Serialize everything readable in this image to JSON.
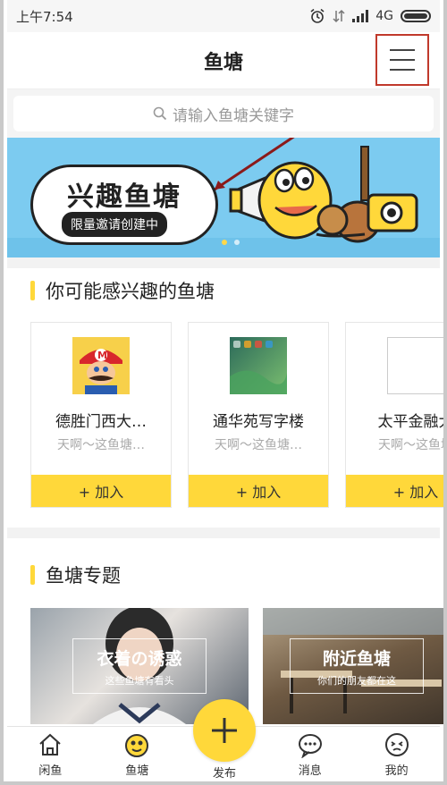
{
  "status_bar": {
    "time": "上午7:54",
    "network": "4G"
  },
  "nav": {
    "title": "鱼塘",
    "menu_icon": "menu-icon"
  },
  "search": {
    "placeholder": "请输入鱼塘关键字"
  },
  "banner": {
    "title": "兴趣鱼塘",
    "subtitle": "限量邀请创建中"
  },
  "recommend": {
    "title": "你可能感兴趣的鱼塘",
    "cards": [
      {
        "name": "德胜门西大…",
        "desc": "天啊～这鱼塘…",
        "join": "+ 加入"
      },
      {
        "name": "通华苑写字楼",
        "desc": "天啊～这鱼塘…",
        "join": "+ 加入"
      },
      {
        "name": "太平金融大",
        "desc": "天啊～这鱼塘",
        "join": "+ 加入"
      }
    ]
  },
  "topics": {
    "title": "鱼塘专题",
    "items": [
      {
        "heading": "衣着の诱惑",
        "sub": "这些鱼塘有看头"
      },
      {
        "heading": "附近鱼塘",
        "sub": "你们的朋友都在这"
      }
    ]
  },
  "tabbar": {
    "items": [
      {
        "label": "闲鱼",
        "icon": "home-icon"
      },
      {
        "label": "鱼塘",
        "icon": "fishpond-icon"
      },
      {
        "label": "发布",
        "icon": "plus-icon"
      },
      {
        "label": "消息",
        "icon": "message-icon"
      },
      {
        "label": "我的",
        "icon": "profile-icon"
      }
    ]
  },
  "colors": {
    "accent": "#ffd83a",
    "banner": "#7ccbf0",
    "highlight_box": "#c0392b"
  }
}
